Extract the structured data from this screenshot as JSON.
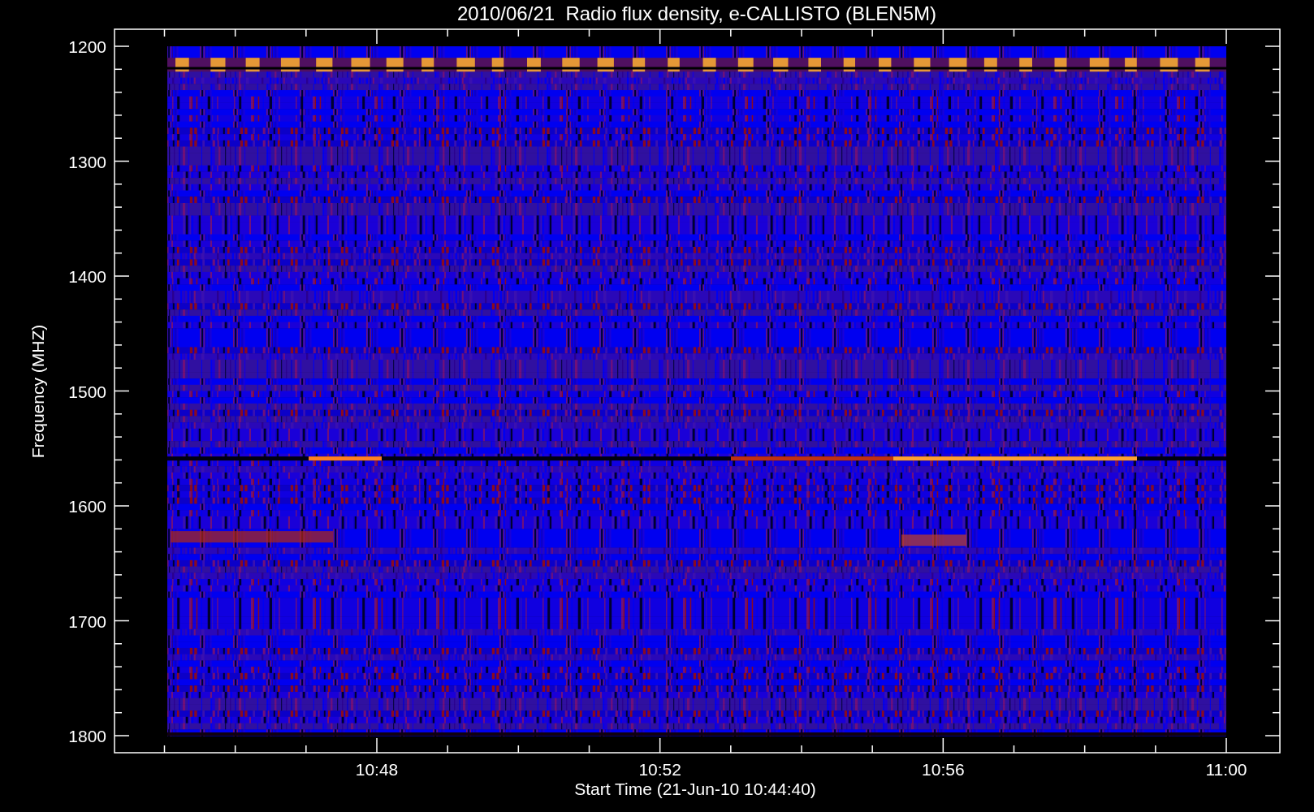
{
  "title": "2010/06/21  Radio flux density, e-CALLISTO (BLEN5M)",
  "y_axis": {
    "label": "Frequency (MHZ)",
    "ticks": [
      "1200",
      "1300",
      "1400",
      "1500",
      "1600",
      "1700",
      "1800"
    ]
  },
  "x_axis": {
    "label": "Start Time (21-Jun-10 10:44:40)",
    "ticks": [
      "10:48",
      "10:52",
      "10:56",
      "11:00"
    ]
  }
}
